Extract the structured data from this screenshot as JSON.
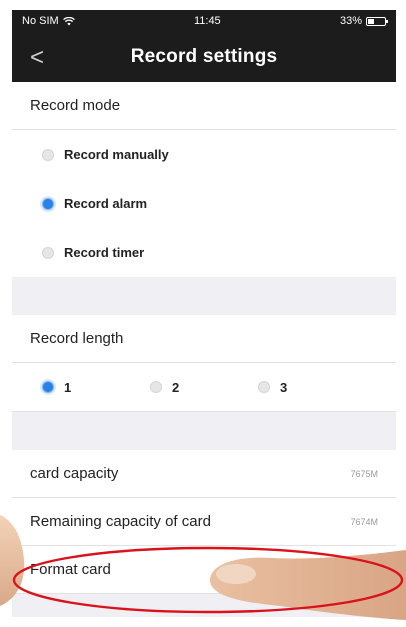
{
  "status_bar": {
    "carrier": "No SIM",
    "time": "11:45",
    "battery": "33%"
  },
  "navbar": {
    "back_glyph": "<",
    "title": "Record settings"
  },
  "record_mode": {
    "header": "Record mode",
    "options": [
      {
        "label": "Record manually",
        "selected": false
      },
      {
        "label": "Record alarm",
        "selected": true
      },
      {
        "label": "Record timer",
        "selected": false
      }
    ]
  },
  "record_length": {
    "header": "Record length",
    "options": [
      {
        "label": "1",
        "selected": true
      },
      {
        "label": "2",
        "selected": false
      },
      {
        "label": "3",
        "selected": false
      }
    ]
  },
  "storage": {
    "card_capacity_label": "card capacity",
    "card_capacity_value": "7675M",
    "remaining_label": "Remaining capacity of card",
    "remaining_value": "7674M",
    "format_label": "Format card"
  },
  "colors": {
    "header_bg": "#1c1c1c",
    "accent": "#2a82e4",
    "highlight_ellipse": "#d9121b"
  }
}
